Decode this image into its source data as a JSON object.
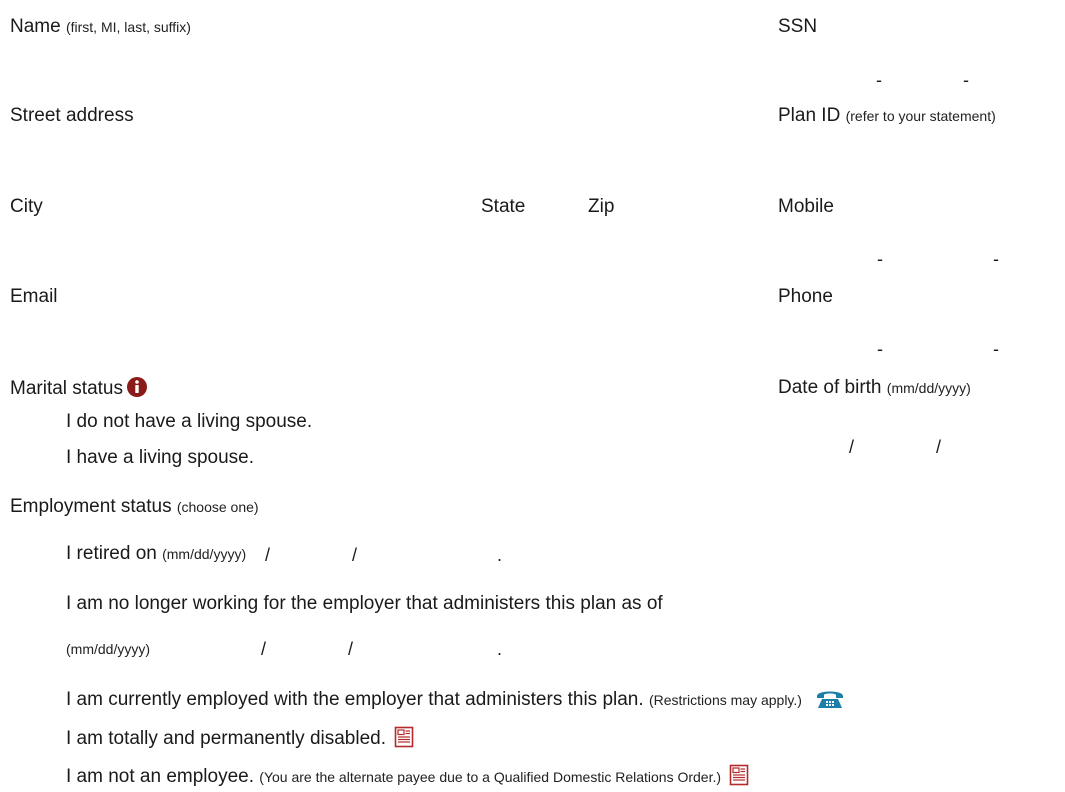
{
  "labels": {
    "name": "Name",
    "name_note": "(first, MI, last, suffix)",
    "ssn": "SSN",
    "street": "Street address",
    "plan_id": "Plan ID",
    "plan_id_note": "(refer to your statement)",
    "city": "City",
    "state": "State",
    "zip": "Zip",
    "mobile": "Mobile",
    "email": "Email",
    "phone": "Phone",
    "marital": "Marital status",
    "dob": "Date of birth",
    "dob_note": "(mm/dd/yyyy)",
    "employment": "Employment status",
    "employment_note": "(choose one)"
  },
  "separators": {
    "dash": "-",
    "slash": "/",
    "period": "."
  },
  "marital_options": [
    "I do not have a living spouse.",
    "I have a living spouse."
  ],
  "employment_options": {
    "retired": "I retired on",
    "retired_note": "(mm/dd/yyyy)",
    "no_longer": "I am no longer working for the employer that administers this plan as of",
    "no_longer_note": "(mm/dd/yyyy)",
    "current": "I am currently employed with the employer that administers this plan.",
    "current_note": "(Restrictions may apply.)",
    "disabled": "I am totally and permanently disabled.",
    "not_employee": "I am not an employee.",
    "not_employee_note": "(You are the alternate payee due to a Qualified Domestic Relations Order.)"
  },
  "colors": {
    "info_icon": "#8b1a1a",
    "phone_icon": "#1b7fa8",
    "doc_icon": "#b52b2b"
  },
  "icons": {
    "info": "info-icon",
    "phone": "phone-icon",
    "document": "document-icon"
  }
}
